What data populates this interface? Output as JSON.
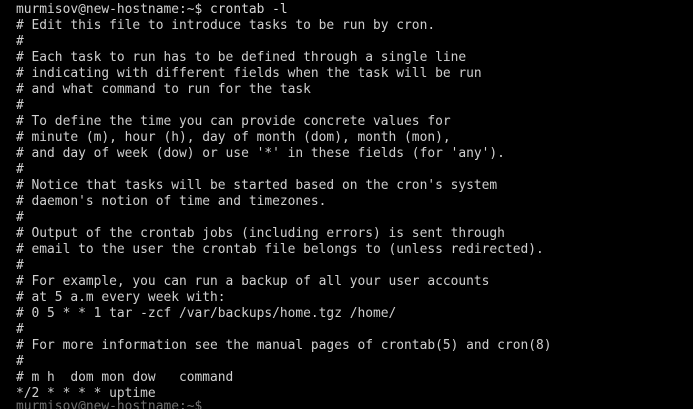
{
  "terminal": {
    "prompt": "murmisov@new-hostname:~$",
    "command": "crontab -l",
    "lines": [
      "# Edit this file to introduce tasks to be run by cron.",
      "#",
      "# Each task to run has to be defined through a single line",
      "# indicating with different fields when the task will be run",
      "# and what command to run for the task",
      "#",
      "# To define the time you can provide concrete values for",
      "# minute (m), hour (h), day of month (dom), month (mon),",
      "# and day of week (dow) or use '*' in these fields (for 'any').",
      "#",
      "# Notice that tasks will be started based on the cron's system",
      "# daemon's notion of time and timezones.",
      "#",
      "# Output of the crontab jobs (including errors) is sent through",
      "# email to the user the crontab file belongs to (unless redirected).",
      "#",
      "# For example, you can run a backup of all your user accounts",
      "# at 5 a.m every week with:",
      "# 0 5 * * 1 tar -zcf /var/backups/home.tgz /home/",
      "#",
      "# For more information see the manual pages of crontab(5) and cron(8)",
      "#",
      "# m h  dom mon dow   command",
      "*/2 * * * * uptime"
    ],
    "partial_line": "murmisov@new-hostname:~$"
  }
}
